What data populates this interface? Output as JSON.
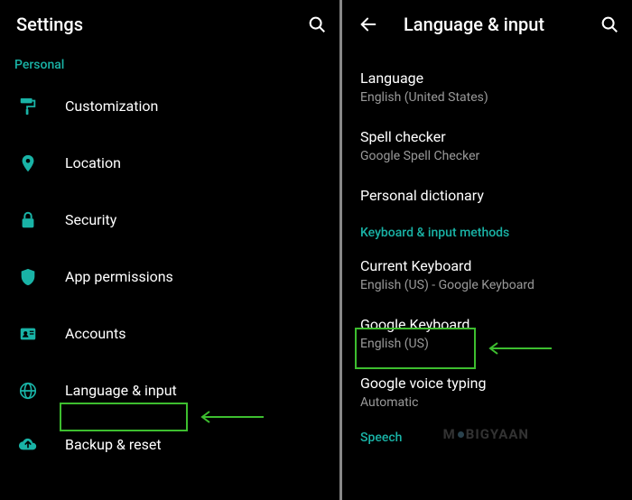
{
  "left": {
    "header": {
      "title": "Settings"
    },
    "section_personal": "Personal",
    "items": {
      "customization": "Customization",
      "location": "Location",
      "security": "Security",
      "app_permissions": "App permissions",
      "accounts": "Accounts",
      "language_input": "Language & input",
      "backup_reset": "Backup & reset"
    }
  },
  "right": {
    "header": {
      "title": "Language & input"
    },
    "items": {
      "language": {
        "title": "Language",
        "sub": "English (United States)"
      },
      "spell_checker": {
        "title": "Spell checker",
        "sub": "Google Spell Checker"
      },
      "personal_dictionary": {
        "title": "Personal dictionary"
      },
      "current_keyboard": {
        "title": "Current Keyboard",
        "sub": "English (US) - Google Keyboard"
      },
      "google_keyboard": {
        "title": "Google Keyboard",
        "sub": "English (US)"
      },
      "google_voice_typing": {
        "title": "Google voice typing",
        "sub": "Automatic"
      }
    },
    "section_keyboard": "Keyboard & input methods",
    "section_speech": "Speech"
  },
  "watermark": "M   BIGYAAN"
}
